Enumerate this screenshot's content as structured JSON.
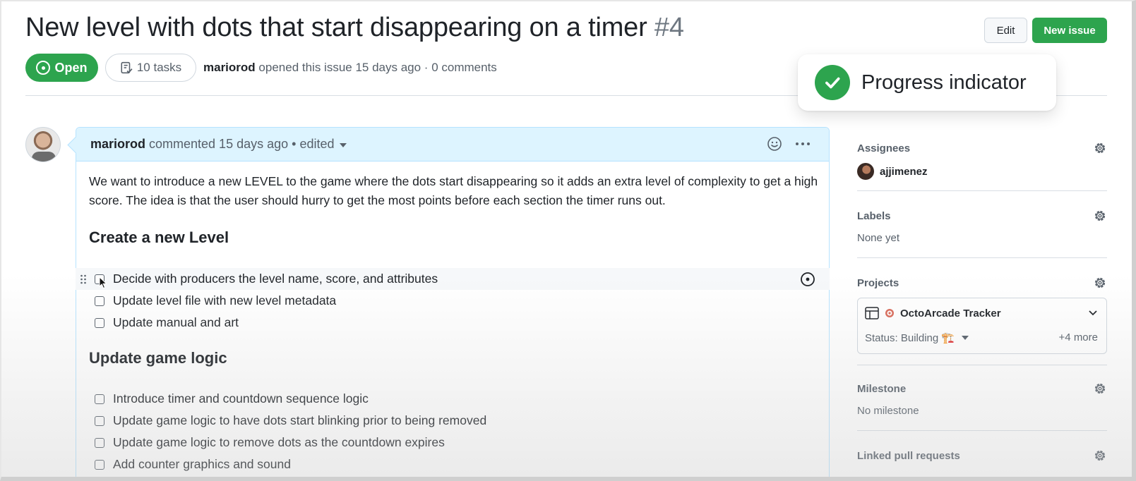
{
  "issue": {
    "title": "New level with dots that start disappearing on a timer",
    "number": "#4",
    "state": "Open",
    "tasks_count": "10 tasks",
    "author": "mariorod",
    "opened_text": "opened this issue 15 days ago · 0 comments"
  },
  "header_actions": {
    "edit_label": "Edit",
    "new_issue_label": "New issue"
  },
  "toast": {
    "label": "Progress indicator"
  },
  "comment": {
    "author": "mariorod",
    "meta": "commented 15 days ago • edited",
    "body": "We want to introduce a new LEVEL to the game where the dots start disappearing so it adds an extra level of complexity to get a high score. The idea is that the user should hurry to get the most points before each section the timer runs out.",
    "sections": [
      {
        "heading": "Create a new Level",
        "tasks": [
          "Decide with producers the level name, score, and attributes",
          "Update level file with new level metadata",
          "Update manual and art"
        ]
      },
      {
        "heading": "Update game logic",
        "tasks": [
          "Introduce timer and countdown sequence logic",
          "Update game logic to have dots start blinking prior to being removed",
          "Update game logic to remove dots as the countdown expires",
          "Add counter graphics and sound"
        ]
      }
    ]
  },
  "sidebar": {
    "assignees": {
      "title": "Assignees",
      "user": "ajjimenez"
    },
    "labels": {
      "title": "Labels",
      "value": "None yet"
    },
    "projects": {
      "title": "Projects",
      "project_name": "OctoArcade Tracker",
      "status": "Status: Building 🏗️",
      "more": "+4 more"
    },
    "milestone": {
      "title": "Milestone",
      "value": "No milestone"
    },
    "linked_prs": {
      "title": "Linked pull requests"
    }
  },
  "colors": {
    "green": "#2da44e",
    "comment_header_bg": "#ddf4ff",
    "comment_border": "#b6e3ff",
    "muted_text": "#57606a"
  }
}
